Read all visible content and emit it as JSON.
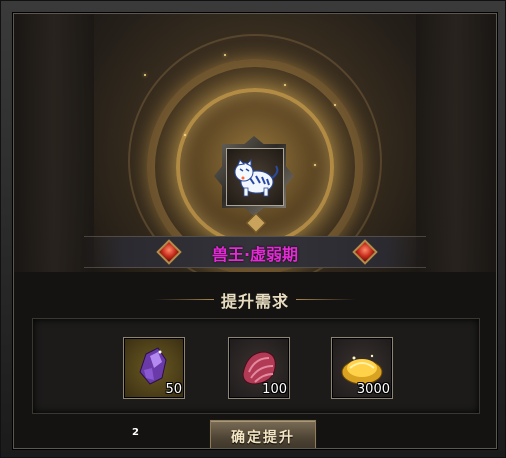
{
  "pet": {
    "name": "兽王·虚弱期",
    "icon": "white-tiger-icon"
  },
  "requirements": {
    "title": "提升需求",
    "items": [
      {
        "icon": "purple-crystal-icon",
        "count": "50"
      },
      {
        "icon": "red-shell-icon",
        "count": "100"
      },
      {
        "icon": "gold-ingot-icon",
        "count": "3000"
      }
    ]
  },
  "footer": {
    "small_number": "2",
    "confirm_label": "确定提升"
  },
  "colors": {
    "pet_name": "#e62ad8",
    "title": "#e8dcc0",
    "button_text": "#f5e6c4"
  }
}
